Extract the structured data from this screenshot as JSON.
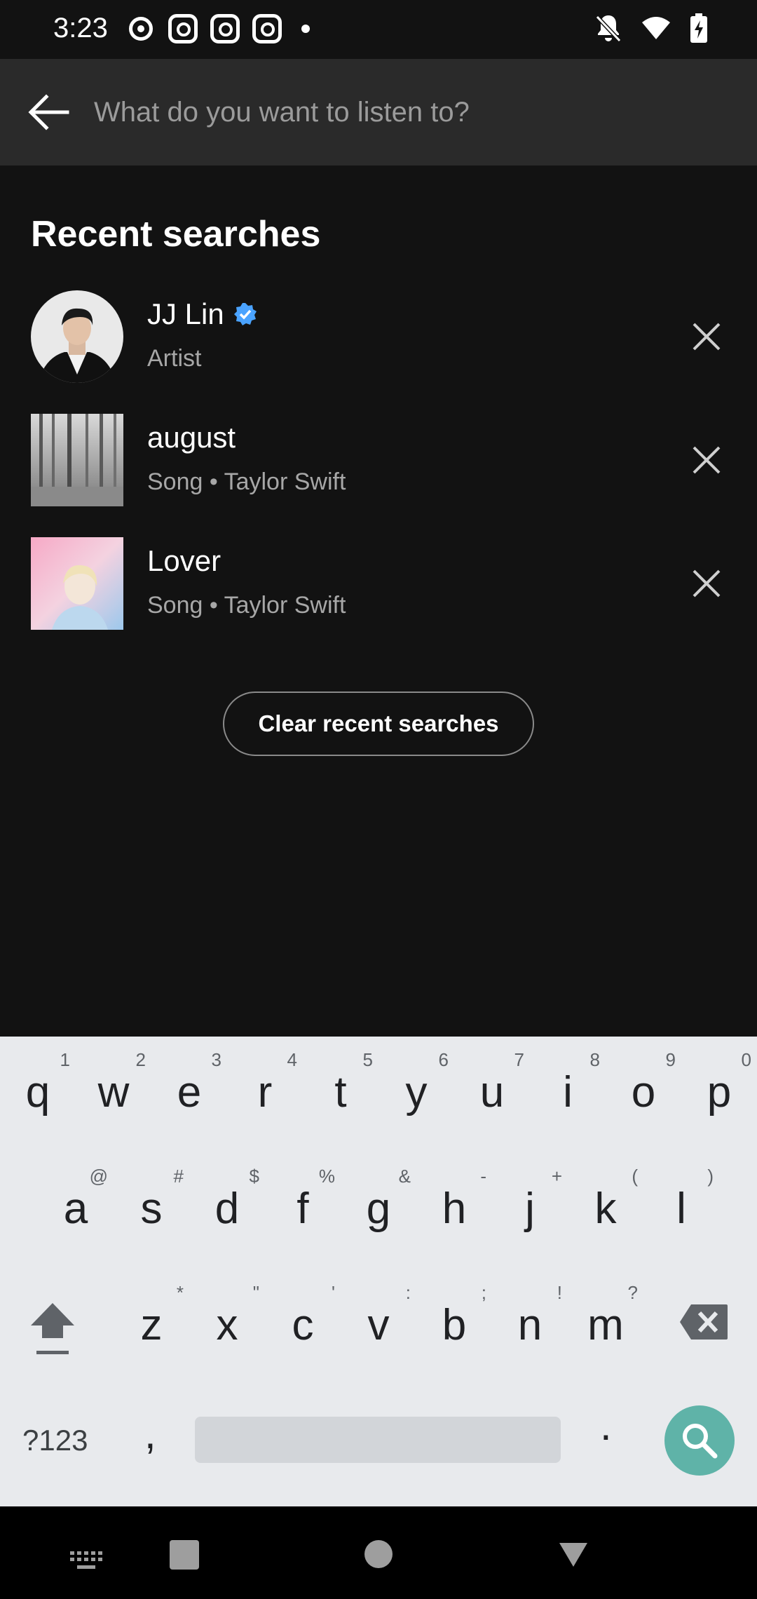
{
  "status_bar": {
    "time": "3:23"
  },
  "search": {
    "placeholder": "What do you want to listen to?"
  },
  "recent": {
    "title": "Recent searches",
    "items": [
      {
        "title": "JJ Lin",
        "subtitle": "Artist",
        "verified": true,
        "thumb_shape": "circle"
      },
      {
        "title": "august",
        "subtitle": "Song • Taylor Swift",
        "thumb_shape": "square"
      },
      {
        "title": "Lover",
        "subtitle": "Song • Taylor Swift",
        "thumb_shape": "square"
      }
    ],
    "clear_label": "Clear recent searches"
  },
  "keyboard": {
    "row1": [
      {
        "k": "q",
        "a": "1"
      },
      {
        "k": "w",
        "a": "2"
      },
      {
        "k": "e",
        "a": "3"
      },
      {
        "k": "r",
        "a": "4"
      },
      {
        "k": "t",
        "a": "5"
      },
      {
        "k": "y",
        "a": "6"
      },
      {
        "k": "u",
        "a": "7"
      },
      {
        "k": "i",
        "a": "8"
      },
      {
        "k": "o",
        "a": "9"
      },
      {
        "k": "p",
        "a": "0"
      }
    ],
    "row2": [
      {
        "k": "a",
        "a": "@"
      },
      {
        "k": "s",
        "a": "#"
      },
      {
        "k": "d",
        "a": "$"
      },
      {
        "k": "f",
        "a": "%"
      },
      {
        "k": "g",
        "a": "&"
      },
      {
        "k": "h",
        "a": "-"
      },
      {
        "k": "j",
        "a": "+"
      },
      {
        "k": "k",
        "a": "("
      },
      {
        "k": "l",
        "a": ")"
      }
    ],
    "row3": [
      {
        "k": "z",
        "a": "*"
      },
      {
        "k": "x",
        "a": "\""
      },
      {
        "k": "c",
        "a": "'"
      },
      {
        "k": "v",
        "a": ":"
      },
      {
        "k": "b",
        "a": ";"
      },
      {
        "k": "n",
        "a": "!"
      },
      {
        "k": "m",
        "a": "?"
      }
    ],
    "symbols_label": "?123",
    "comma": ",",
    "period": "."
  },
  "colors": {
    "background": "#121212",
    "header": "#2a2a2a",
    "verified": "#4aa3ff",
    "keyboard_bg": "#e8eaed",
    "search_key": "#5fb3a8"
  },
  "icons": {
    "back": "arrow-left-icon",
    "remove": "close-icon",
    "verified": "verified-badge-icon",
    "shift": "shift-icon",
    "backspace": "backspace-icon",
    "search_key": "search-icon"
  }
}
